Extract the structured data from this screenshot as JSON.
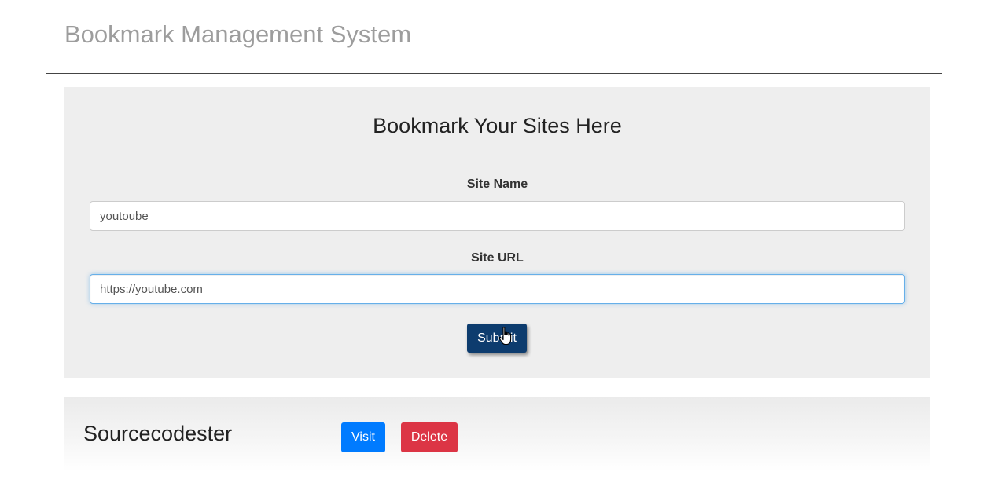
{
  "header": {
    "title": "Bookmark Management System"
  },
  "form": {
    "heading": "Bookmark Your Sites Here",
    "site_name_label": "Site Name",
    "site_name_value": "youtoube",
    "site_url_label": "Site URL",
    "site_url_value": "https://youtube.com",
    "submit_label": "Submit"
  },
  "bookmarks": [
    {
      "name": "Sourcecodester",
      "visit_label": "Visit",
      "delete_label": "Delete"
    }
  ],
  "colors": {
    "title_gray": "#9d9d9d",
    "panel_bg": "#eeeeee",
    "submit_bg": "#0d3c6e",
    "visit_bg": "#007bff",
    "delete_bg": "#dc3545",
    "focus_border": "#66afe9"
  },
  "icons": {
    "cursor": "hand-pointer-icon"
  }
}
